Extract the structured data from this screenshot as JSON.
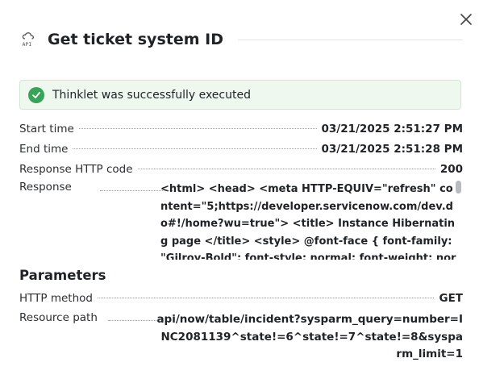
{
  "dialog": {
    "title": "Get ticket system ID",
    "icon": "api-cloud-icon",
    "close_icon": "close-icon"
  },
  "banner": {
    "text": "Thinklet was successfully executed",
    "status": "success",
    "color": "#3aa35a"
  },
  "details": {
    "start_time_label": "Start time",
    "start_time_value": "03/21/2025 2:51:27 PM",
    "end_time_label": "End time",
    "end_time_value": "03/21/2025 2:51:28 PM",
    "http_code_label": "Response HTTP code",
    "http_code_value": "200",
    "response_label": "Response",
    "response_value": "<html> <head> <meta HTTP-EQUIV=\"refresh\" content=\"5;https://developer.servicenow.com/dev.do#!/home?wu=true\"> <title> Instance Hibernating page </title> <style> @font-face { font-family: \"Gilroy-Bold\"; font-style: normal; font-weight: norma"
  },
  "parameters": {
    "heading": "Parameters",
    "http_method_label": "HTTP method",
    "http_method_value": "GET",
    "resource_path_label": "Resource path",
    "resource_path_value": "api/now/table/incident?sysparm_query=number=INC2081139^state!=6^state!=7^state!=8&sysparm_limit=1"
  }
}
